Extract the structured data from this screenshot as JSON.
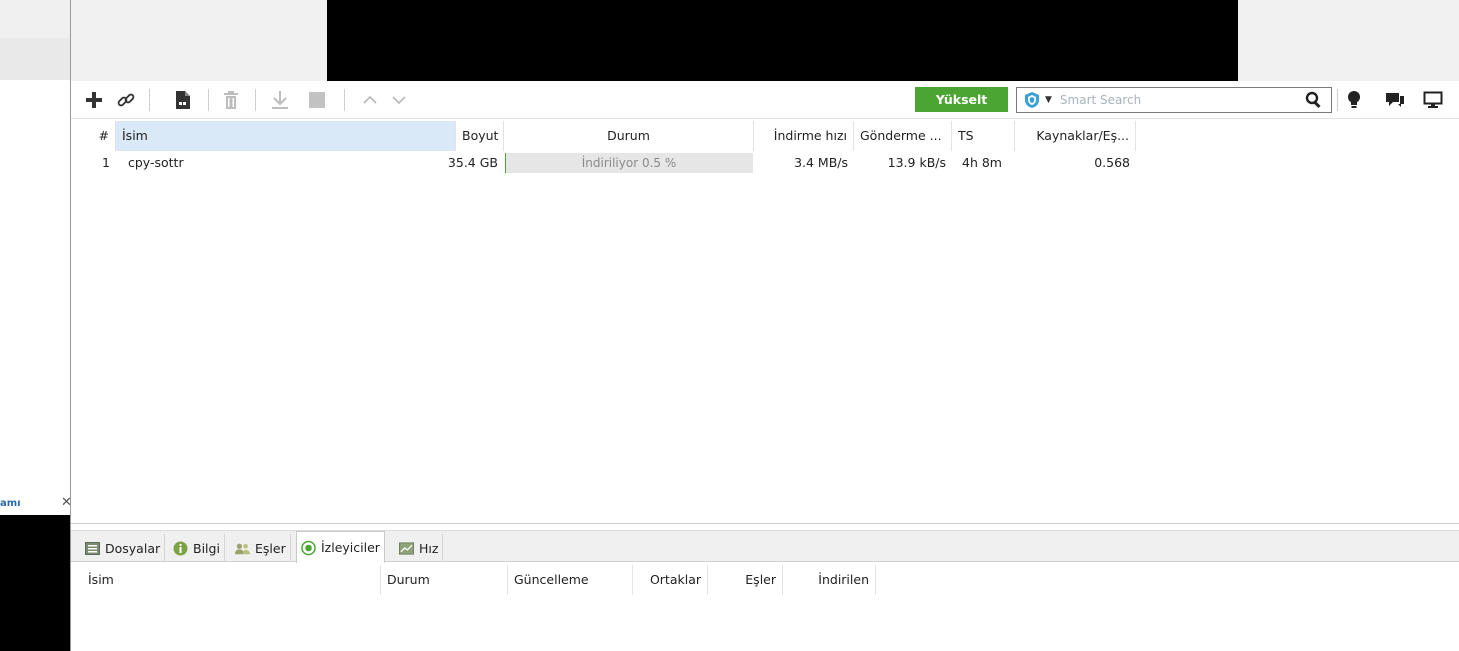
{
  "sidebar": {
    "tab_label": "amı",
    "close_glyph": "✕"
  },
  "toolbar": {
    "upgrade_label": "Yükselt",
    "search_placeholder": "Smart Search",
    "icons": [
      "add-torrent-icon",
      "add-link-icon",
      "create-torrent-icon",
      "delete-icon",
      "download-icon",
      "stop-icon",
      "move-up-icon",
      "move-down-icon",
      "bulb-icon",
      "chat-icon",
      "remote-icon"
    ]
  },
  "torrent_list": {
    "columns": {
      "num": "#",
      "name": "İsim",
      "size": "Boyut",
      "status": "Durum",
      "down_speed": "İndirme hızı",
      "up_speed": "Gönderme ...",
      "eta": "TS",
      "ratio": "Kaynaklar/Eş..."
    },
    "rows": [
      {
        "num": "1",
        "name": "cpy-sottr",
        "size": "35.4 GB",
        "status": "İndiriliyor 0.5 %",
        "progress_fraction": 0.005,
        "down_speed": "3.4 MB/s",
        "up_speed": "13.9 kB/s",
        "eta": "4h 8m",
        "ratio": "0.568"
      }
    ]
  },
  "detail_tabs": [
    {
      "label": "Dosyalar",
      "icon": "files-icon"
    },
    {
      "label": "Bilgi",
      "icon": "info-icon"
    },
    {
      "label": "Eşler",
      "icon": "peers-icon"
    },
    {
      "label": "İzleyiciler",
      "icon": "trackers-icon",
      "active": true
    },
    {
      "label": "Hız",
      "icon": "speed-icon"
    }
  ],
  "tracker_columns": {
    "name": "İsim",
    "status": "Durum",
    "update": "Güncelleme",
    "seeds": "Ortaklar",
    "peers": "Eşler",
    "downloaded": "İndirilen"
  },
  "colors": {
    "accent_green": "#4ba532",
    "sorted_header": "#d9e9f7",
    "sidebar_link": "#2a6ab0"
  }
}
